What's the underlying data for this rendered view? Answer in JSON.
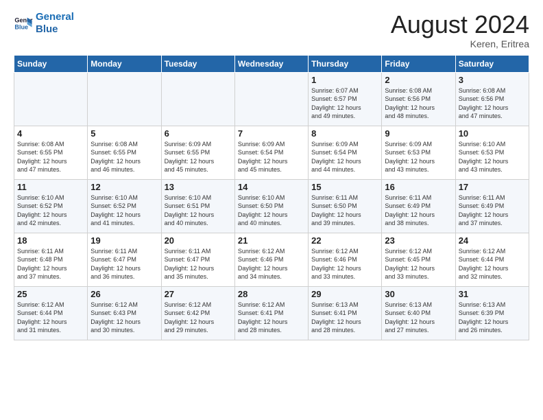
{
  "header": {
    "logo_line1": "General",
    "logo_line2": "Blue",
    "month": "August 2024",
    "location": "Keren, Eritrea"
  },
  "days_of_week": [
    "Sunday",
    "Monday",
    "Tuesday",
    "Wednesday",
    "Thursday",
    "Friday",
    "Saturday"
  ],
  "weeks": [
    [
      {
        "day": "",
        "info": ""
      },
      {
        "day": "",
        "info": ""
      },
      {
        "day": "",
        "info": ""
      },
      {
        "day": "",
        "info": ""
      },
      {
        "day": "1",
        "info": "Sunrise: 6:07 AM\nSunset: 6:57 PM\nDaylight: 12 hours\nand 49 minutes."
      },
      {
        "day": "2",
        "info": "Sunrise: 6:08 AM\nSunset: 6:56 PM\nDaylight: 12 hours\nand 48 minutes."
      },
      {
        "day": "3",
        "info": "Sunrise: 6:08 AM\nSunset: 6:56 PM\nDaylight: 12 hours\nand 47 minutes."
      }
    ],
    [
      {
        "day": "4",
        "info": "Sunrise: 6:08 AM\nSunset: 6:55 PM\nDaylight: 12 hours\nand 47 minutes."
      },
      {
        "day": "5",
        "info": "Sunrise: 6:08 AM\nSunset: 6:55 PM\nDaylight: 12 hours\nand 46 minutes."
      },
      {
        "day": "6",
        "info": "Sunrise: 6:09 AM\nSunset: 6:55 PM\nDaylight: 12 hours\nand 45 minutes."
      },
      {
        "day": "7",
        "info": "Sunrise: 6:09 AM\nSunset: 6:54 PM\nDaylight: 12 hours\nand 45 minutes."
      },
      {
        "day": "8",
        "info": "Sunrise: 6:09 AM\nSunset: 6:54 PM\nDaylight: 12 hours\nand 44 minutes."
      },
      {
        "day": "9",
        "info": "Sunrise: 6:09 AM\nSunset: 6:53 PM\nDaylight: 12 hours\nand 43 minutes."
      },
      {
        "day": "10",
        "info": "Sunrise: 6:10 AM\nSunset: 6:53 PM\nDaylight: 12 hours\nand 43 minutes."
      }
    ],
    [
      {
        "day": "11",
        "info": "Sunrise: 6:10 AM\nSunset: 6:52 PM\nDaylight: 12 hours\nand 42 minutes."
      },
      {
        "day": "12",
        "info": "Sunrise: 6:10 AM\nSunset: 6:52 PM\nDaylight: 12 hours\nand 41 minutes."
      },
      {
        "day": "13",
        "info": "Sunrise: 6:10 AM\nSunset: 6:51 PM\nDaylight: 12 hours\nand 40 minutes."
      },
      {
        "day": "14",
        "info": "Sunrise: 6:10 AM\nSunset: 6:50 PM\nDaylight: 12 hours\nand 40 minutes."
      },
      {
        "day": "15",
        "info": "Sunrise: 6:11 AM\nSunset: 6:50 PM\nDaylight: 12 hours\nand 39 minutes."
      },
      {
        "day": "16",
        "info": "Sunrise: 6:11 AM\nSunset: 6:49 PM\nDaylight: 12 hours\nand 38 minutes."
      },
      {
        "day": "17",
        "info": "Sunrise: 6:11 AM\nSunset: 6:49 PM\nDaylight: 12 hours\nand 37 minutes."
      }
    ],
    [
      {
        "day": "18",
        "info": "Sunrise: 6:11 AM\nSunset: 6:48 PM\nDaylight: 12 hours\nand 37 minutes."
      },
      {
        "day": "19",
        "info": "Sunrise: 6:11 AM\nSunset: 6:47 PM\nDaylight: 12 hours\nand 36 minutes."
      },
      {
        "day": "20",
        "info": "Sunrise: 6:11 AM\nSunset: 6:47 PM\nDaylight: 12 hours\nand 35 minutes."
      },
      {
        "day": "21",
        "info": "Sunrise: 6:12 AM\nSunset: 6:46 PM\nDaylight: 12 hours\nand 34 minutes."
      },
      {
        "day": "22",
        "info": "Sunrise: 6:12 AM\nSunset: 6:46 PM\nDaylight: 12 hours\nand 33 minutes."
      },
      {
        "day": "23",
        "info": "Sunrise: 6:12 AM\nSunset: 6:45 PM\nDaylight: 12 hours\nand 33 minutes."
      },
      {
        "day": "24",
        "info": "Sunrise: 6:12 AM\nSunset: 6:44 PM\nDaylight: 12 hours\nand 32 minutes."
      }
    ],
    [
      {
        "day": "25",
        "info": "Sunrise: 6:12 AM\nSunset: 6:44 PM\nDaylight: 12 hours\nand 31 minutes."
      },
      {
        "day": "26",
        "info": "Sunrise: 6:12 AM\nSunset: 6:43 PM\nDaylight: 12 hours\nand 30 minutes."
      },
      {
        "day": "27",
        "info": "Sunrise: 6:12 AM\nSunset: 6:42 PM\nDaylight: 12 hours\nand 29 minutes."
      },
      {
        "day": "28",
        "info": "Sunrise: 6:12 AM\nSunset: 6:41 PM\nDaylight: 12 hours\nand 28 minutes."
      },
      {
        "day": "29",
        "info": "Sunrise: 6:13 AM\nSunset: 6:41 PM\nDaylight: 12 hours\nand 28 minutes."
      },
      {
        "day": "30",
        "info": "Sunrise: 6:13 AM\nSunset: 6:40 PM\nDaylight: 12 hours\nand 27 minutes."
      },
      {
        "day": "31",
        "info": "Sunrise: 6:13 AM\nSunset: 6:39 PM\nDaylight: 12 hours\nand 26 minutes."
      }
    ]
  ]
}
